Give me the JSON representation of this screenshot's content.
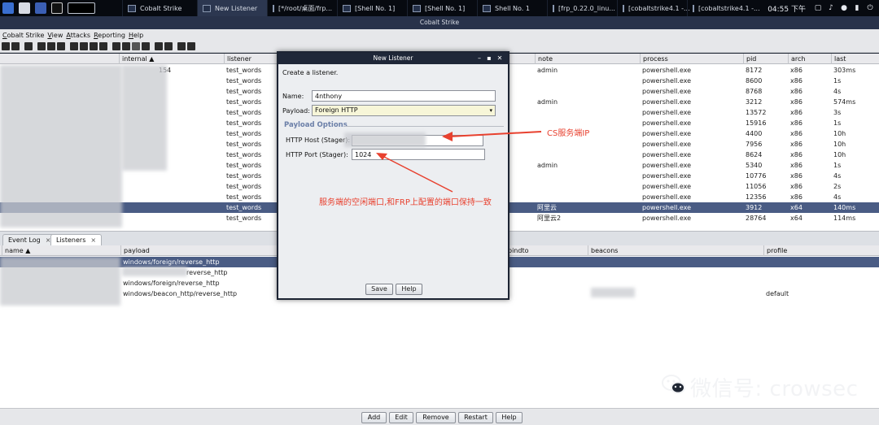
{
  "taskbar": {
    "tasks": [
      {
        "label": "Cobalt Strike",
        "active": false
      },
      {
        "label": "New Listener",
        "active": true
      },
      {
        "label": "[*/root/桌面/frp...",
        "active": false
      },
      {
        "label": "[Shell No. 1]",
        "active": false
      },
      {
        "label": "[Shell No. 1]",
        "active": false
      },
      {
        "label": "Shell No. 1",
        "active": false
      },
      {
        "label": "[frp_0.22.0_linu...",
        "active": false
      },
      {
        "label": "[cobaltstrike4.1 -...",
        "active": false
      },
      {
        "label": "[cobaltstrike4.1 -...",
        "active": false
      }
    ],
    "clock": "04:55 下午"
  },
  "window": {
    "title": "Cobalt Strike"
  },
  "menu": [
    "Cobalt Strike",
    "View",
    "Attacks",
    "Reporting",
    "Help"
  ],
  "sessions": {
    "columns": [
      "internal",
      "listener",
      "note",
      "process",
      "pid",
      "arch",
      "last"
    ],
    "sort_indicator": "▲",
    "partial_ip": "154",
    "rows": [
      {
        "listener": "test_words",
        "note": "admin",
        "process": "powershell.exe",
        "pid": "8172",
        "arch": "x86",
        "last": "303ms"
      },
      {
        "listener": "test_words",
        "note": "",
        "process": "powershell.exe",
        "pid": "8600",
        "arch": "x86",
        "last": "1s"
      },
      {
        "listener": "test_words",
        "note": "",
        "process": "powershell.exe",
        "pid": "8768",
        "arch": "x86",
        "last": "4s"
      },
      {
        "listener": "test_words",
        "note": "admin",
        "process": "powershell.exe",
        "pid": "3212",
        "arch": "x86",
        "last": "574ms"
      },
      {
        "listener": "test_words",
        "note": "",
        "process": "powershell.exe",
        "pid": "13572",
        "arch": "x86",
        "last": "3s"
      },
      {
        "listener": "test_words",
        "note": "",
        "process": "powershell.exe",
        "pid": "15916",
        "arch": "x86",
        "last": "1s"
      },
      {
        "listener": "test_words",
        "note": "",
        "process": "powershell.exe",
        "pid": "4400",
        "arch": "x86",
        "last": "10h"
      },
      {
        "listener": "test_words",
        "note": "",
        "process": "powershell.exe",
        "pid": "7956",
        "arch": "x86",
        "last": "10h"
      },
      {
        "listener": "test_words",
        "note": "",
        "process": "powershell.exe",
        "pid": "8624",
        "arch": "x86",
        "last": "10h"
      },
      {
        "listener": "test_words",
        "note": "admin",
        "process": "powershell.exe",
        "pid": "5340",
        "arch": "x86",
        "last": "1s"
      },
      {
        "listener": "test_words",
        "note": "",
        "process": "powershell.exe",
        "pid": "10776",
        "arch": "x86",
        "last": "4s"
      },
      {
        "listener": "test_words",
        "note": "",
        "process": "powershell.exe",
        "pid": "11056",
        "arch": "x86",
        "last": "2s"
      },
      {
        "listener": "test_words",
        "note": "",
        "process": "powershell.exe",
        "pid": "12356",
        "arch": "x86",
        "last": "4s"
      },
      {
        "listener": "test_words",
        "note": "阿里云",
        "process": "powershell.exe",
        "pid": "3912",
        "arch": "x64",
        "last": "140ms",
        "selected": true
      },
      {
        "listener": "test_words",
        "note": "阿里云2",
        "process": "powershell.exe",
        "pid": "28764",
        "arch": "x64",
        "last": "114ms"
      }
    ]
  },
  "tabs": [
    {
      "label": "Event Log",
      "closable": true
    },
    {
      "label": "Listeners",
      "closable": true,
      "active": true
    }
  ],
  "listeners": {
    "columns": [
      "name",
      "payload",
      "bindto",
      "beacons",
      "profile"
    ],
    "sort_indicator": "▲",
    "rows": [
      {
        "payload": "windows/foreign/reverse_http",
        "profile": "",
        "selected": true
      },
      {
        "payload": "reverse_http",
        "profile": ""
      },
      {
        "payload": "windows/foreign/reverse_http",
        "profile": ""
      },
      {
        "payload": "windows/beacon_http/reverse_http",
        "profile": "default"
      }
    ]
  },
  "bottom_buttons": [
    "Add",
    "Edit",
    "Remove",
    "Restart",
    "Help"
  ],
  "dialog": {
    "title": "New Listener",
    "intro": "Create a listener.",
    "name_label": "Name:",
    "name_value": "4nthony",
    "payload_label": "Payload:",
    "payload_value": "Foreign HTTP",
    "section": "Payload Options",
    "host_label": "HTTP Host (Stager):",
    "port_label": "HTTP Port (Stager):",
    "port_value": "1024",
    "save": "Save",
    "help": "Help"
  },
  "annotations": {
    "host_note": "CS服务端IP",
    "port_note": "服务端的空闲端口,和FRP上配置的端口保持一致",
    "color": "#e8412f"
  },
  "watermark": "微信号: crowsec"
}
